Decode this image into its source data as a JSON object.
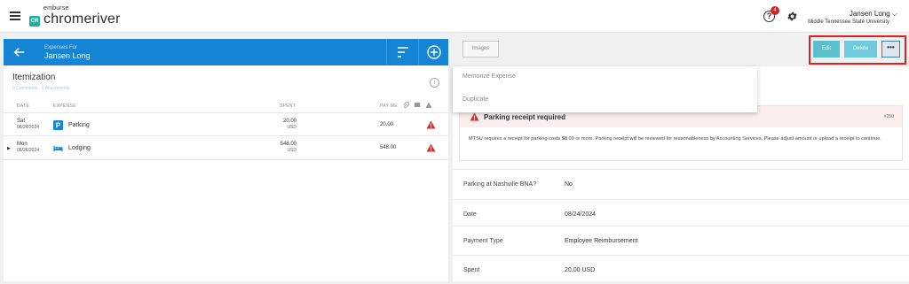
{
  "app": {
    "brand_small": "emburse",
    "brand_main": "chromeriver",
    "brand_badge": "CR",
    "help_badge_count": "4",
    "user_name": "Jansen Long",
    "user_org": "Middle Tennessee State University"
  },
  "left": {
    "header_label": "Expenses For",
    "header_name": "Jansen Long",
    "section_title": "Itemization",
    "meta": "0 Comments · 0 Attachments",
    "columns": {
      "date": "DATE",
      "expense": "EXPENSE",
      "spent": "SPENT",
      "pay_me": "PAY ME"
    },
    "rows": [
      {
        "dow": "Sat",
        "date": "08/24/2024",
        "category": "Parking",
        "icon": "parking-icon",
        "amount": "20.00",
        "currency": "USD",
        "pay_me": "20.00",
        "has_warning": true
      },
      {
        "dow": "Mon",
        "date": "08/26/2024",
        "category": "Lodging",
        "icon": "bed-icon",
        "amount": "548.00",
        "currency": "USD",
        "pay_me": "548.00",
        "has_warning": true
      }
    ]
  },
  "right": {
    "images_label": "Images",
    "edit_label": "Edit",
    "delete_label": "Delete",
    "more_label": "•••",
    "menu": [
      "Memorize Expense",
      "Duplicate"
    ],
    "alert": {
      "title": "Parking receipt required",
      "code": "#250",
      "body": "MTSU requires a receipt for parking costs $8.00 or more. Parking receipt will be reviewed for reasonableness by Accounting Services. Please adjust amount or upload a receipt to continue."
    },
    "fields": [
      {
        "label": "Parking at Nashville BNA?",
        "value": "No"
      },
      {
        "label": "Date",
        "value": "08/24/2024"
      },
      {
        "label": "Payment Type",
        "value": "Employee Reimbursement"
      },
      {
        "label": "Spent",
        "value": "20.00 USD"
      }
    ]
  },
  "colors": {
    "header_blue": "#1584d4",
    "teal_button": "#5bc0ce",
    "warning_red": "#d32f2f",
    "highlight_red": "#e02020",
    "alert_bg": "#fbeeee"
  }
}
